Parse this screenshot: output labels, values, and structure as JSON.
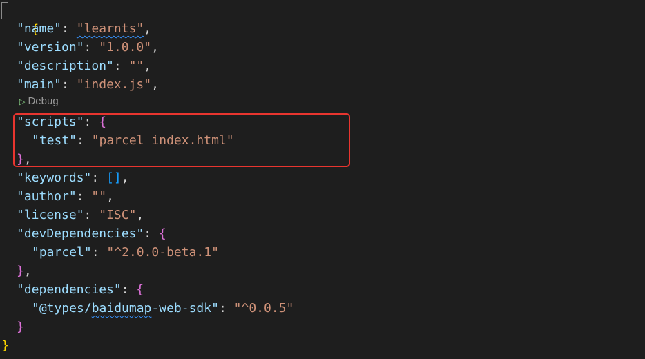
{
  "code": {
    "open_brace": "{",
    "close_brace": "}",
    "name_key": "\"name\"",
    "name_value": "\"learnts\"",
    "version_key": "\"version\"",
    "version_value": "\"1.0.0\"",
    "description_key": "\"description\"",
    "description_value": "\"\"",
    "main_key": "\"main\"",
    "main_value": "\"index.js\"",
    "scripts_key": "\"scripts\"",
    "test_key": "\"test\"",
    "test_value": "\"parcel index.html\"",
    "keywords_key": "\"keywords\"",
    "keywords_value": "[]",
    "author_key": "\"author\"",
    "author_value": "\"\"",
    "license_key": "\"license\"",
    "license_value": "\"ISC\"",
    "devdeps_key": "\"devDependencies\"",
    "parcel_key": "\"parcel\"",
    "parcel_value": "\"^2.0.0-beta.1\"",
    "deps_key": "\"dependencies\"",
    "baidumap_key_prefix": "\"@types/",
    "baidumap_key_squiggle": "baidumap",
    "baidumap_key_suffix": "-web-sdk\"",
    "baidumap_value": "\"^0.0.5\""
  },
  "codelens": {
    "debug_label": "Debug"
  },
  "colors": {
    "background": "#1e1e1e",
    "key": "#9cdcfe",
    "string": "#ce9178",
    "highlight_border": "#e8352f"
  }
}
